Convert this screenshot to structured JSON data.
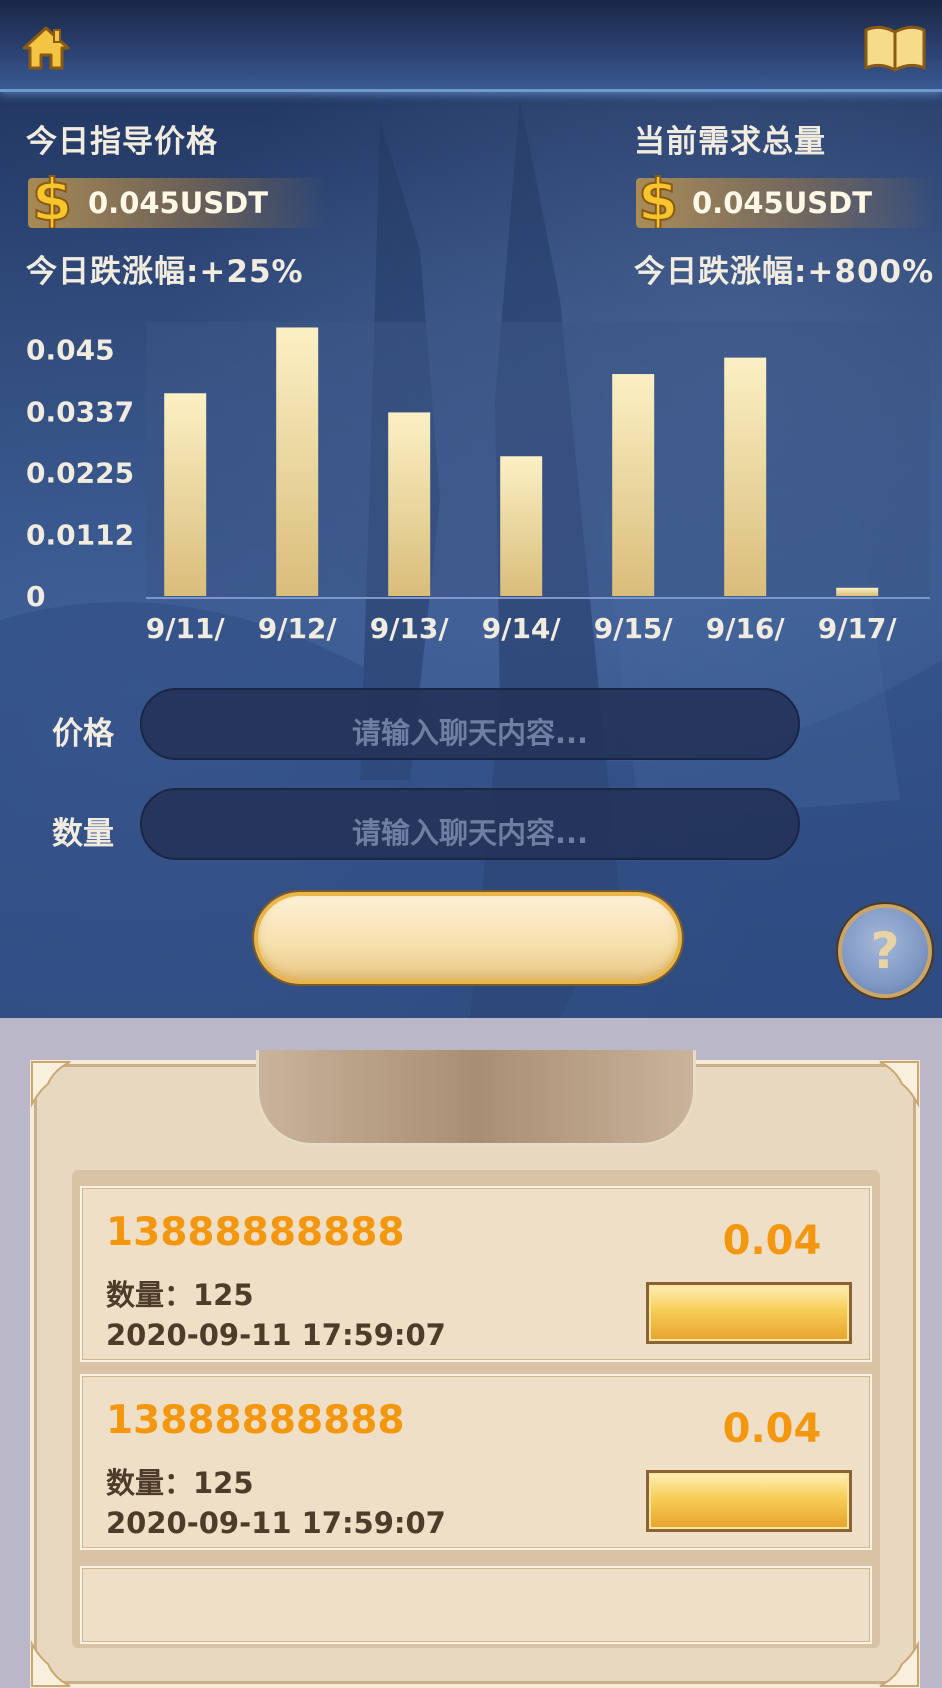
{
  "header": {
    "home_icon": "home-icon",
    "book_icon": "book-icon"
  },
  "stats": {
    "left": {
      "title": "今日指导价格",
      "price": "0.045USDT",
      "change": "今日跌涨幅:+25%"
    },
    "right": {
      "title": "当前需求总量",
      "price": "0.045USDT",
      "change": "今日跌涨幅:+800%"
    }
  },
  "chart_data": {
    "type": "bar",
    "categories": [
      "9/11/",
      "9/12/",
      "9/13/",
      "9/14/",
      "9/15/",
      "9/16/",
      "9/17/"
    ],
    "values": [
      0.037,
      0.049,
      0.0335,
      0.0255,
      0.0405,
      0.0435,
      0.0015
    ],
    "yticks": [
      "0.045",
      "0.0337",
      "0.0225",
      "0.0112",
      "0"
    ],
    "ylim": [
      0,
      0.05
    ],
    "bar_color_top": "#fbf0c4",
    "bar_color_bottom": "#d9bd7a",
    "grid": false
  },
  "form": {
    "price_label": "价格",
    "price_placeholder": "请输入聊天内容...",
    "quantity_label": "数量",
    "quantity_placeholder": "请输入聊天内容...",
    "submit_label": "",
    "help_label": "?"
  },
  "records": [
    {
      "phone": "13888888888",
      "quantity": "数量：125",
      "date": "2020-09-11 17:59:07",
      "price": "0.04",
      "action_label": ""
    },
    {
      "phone": "13888888888",
      "quantity": "数量：125",
      "date": "2020-09-11 17:59:07",
      "price": "0.04",
      "action_label": ""
    }
  ],
  "colors": {
    "accent_orange": "#f3970f",
    "gold": "#e9b64c"
  }
}
